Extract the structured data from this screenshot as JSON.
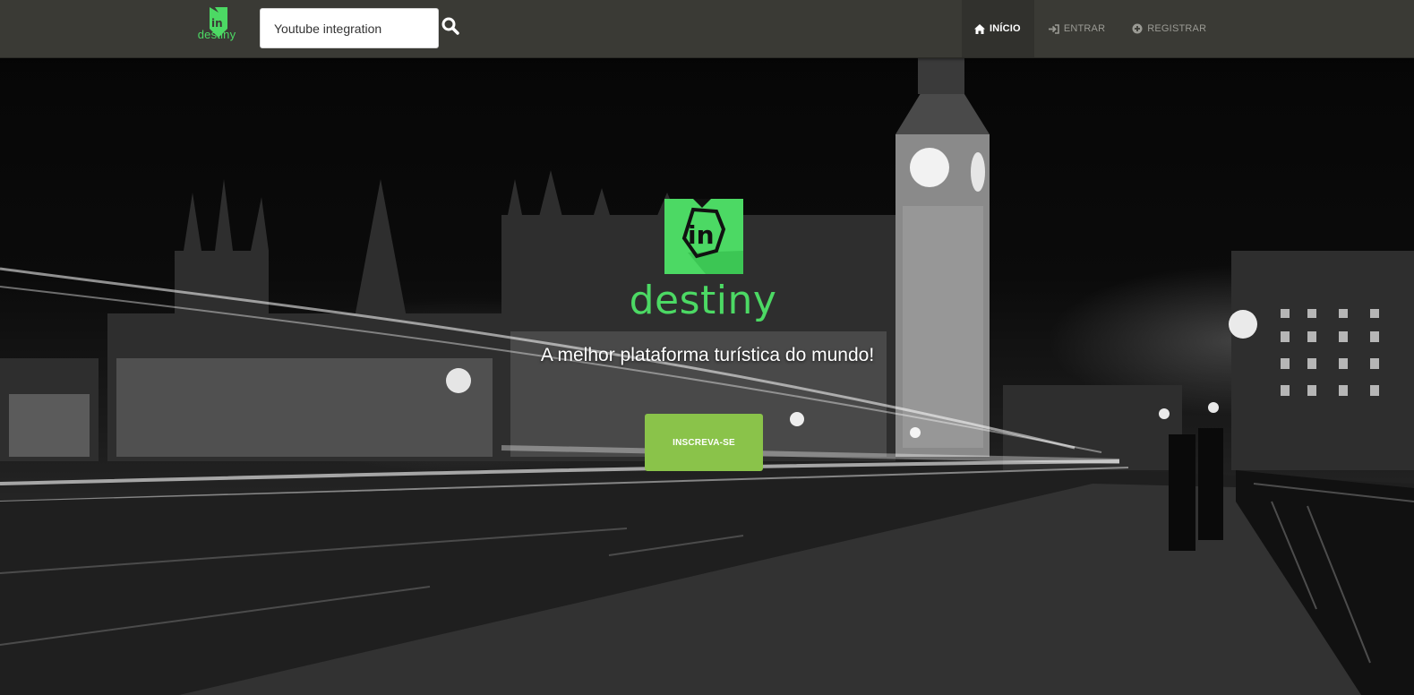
{
  "navbar": {
    "logo_text": "destiny",
    "search": {
      "value": "Youtube integration",
      "placeholder": ""
    },
    "menu": [
      {
        "label": "INÍCIO",
        "icon": "home-icon",
        "active": true
      },
      {
        "label": "ENTRAR",
        "icon": "sign-in-icon",
        "active": false
      },
      {
        "label": "REGISTRAR",
        "icon": "plus-circle-icon",
        "active": false
      }
    ]
  },
  "hero": {
    "logo_text": "destiny",
    "logo_mark": "in",
    "tagline": "A melhor plataforma turística do mundo!",
    "cta_label": "INSCREVA-SE",
    "background": "black-and-white night photo of Big Ben and the Houses of Parliament with light trails"
  },
  "colors": {
    "brand_green": "#4cd964",
    "cta_green": "#8ac34a",
    "navbar_bg": "#3a3a35",
    "navbar_active_bg": "#31312d"
  }
}
